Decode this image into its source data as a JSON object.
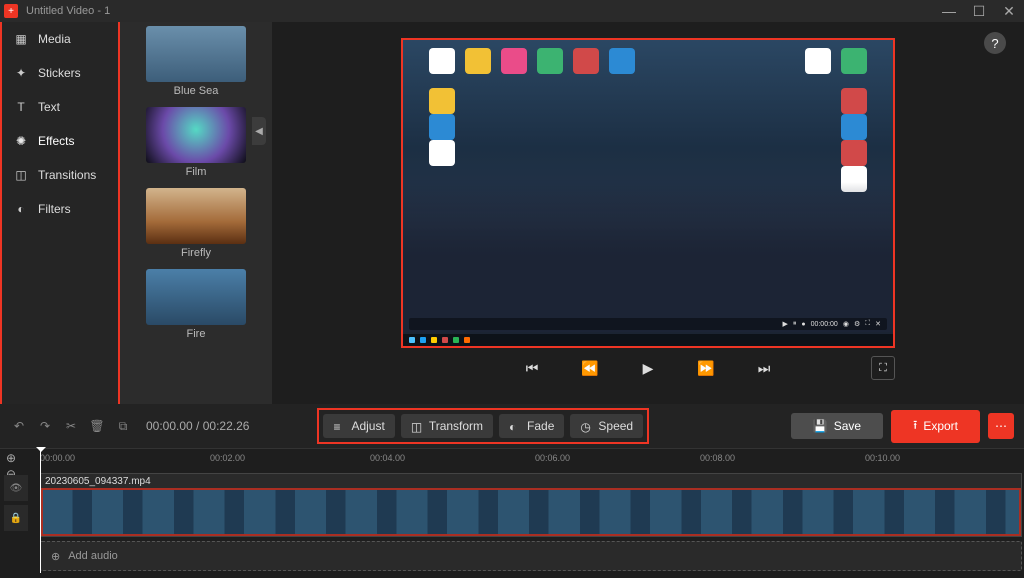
{
  "title": "Untitled Video - 1",
  "sidebar": {
    "items": [
      {
        "label": "Media"
      },
      {
        "label": "Stickers"
      },
      {
        "label": "Text"
      },
      {
        "label": "Effects"
      },
      {
        "label": "Transitions"
      },
      {
        "label": "Filters"
      }
    ]
  },
  "asset_panel": {
    "items": [
      {
        "label": "Blue Sea"
      },
      {
        "label": "Film"
      },
      {
        "label": "Firefly"
      },
      {
        "label": "Fire"
      }
    ]
  },
  "toolbar": {
    "time_current": "00:00.00",
    "time_total": "00:22.26",
    "adjust": "Adjust",
    "transform": "Transform",
    "fade": "Fade",
    "speed": "Speed",
    "save": "Save",
    "export": "Export"
  },
  "timeline": {
    "ticks": [
      "00:00.00",
      "00:02.00",
      "00:04.00",
      "00:06.00",
      "00:08.00",
      "00:10.00"
    ],
    "clip_name": "20230605_094337.mp4",
    "audio_label": "Add audio"
  },
  "misc": {
    "help": "?"
  }
}
